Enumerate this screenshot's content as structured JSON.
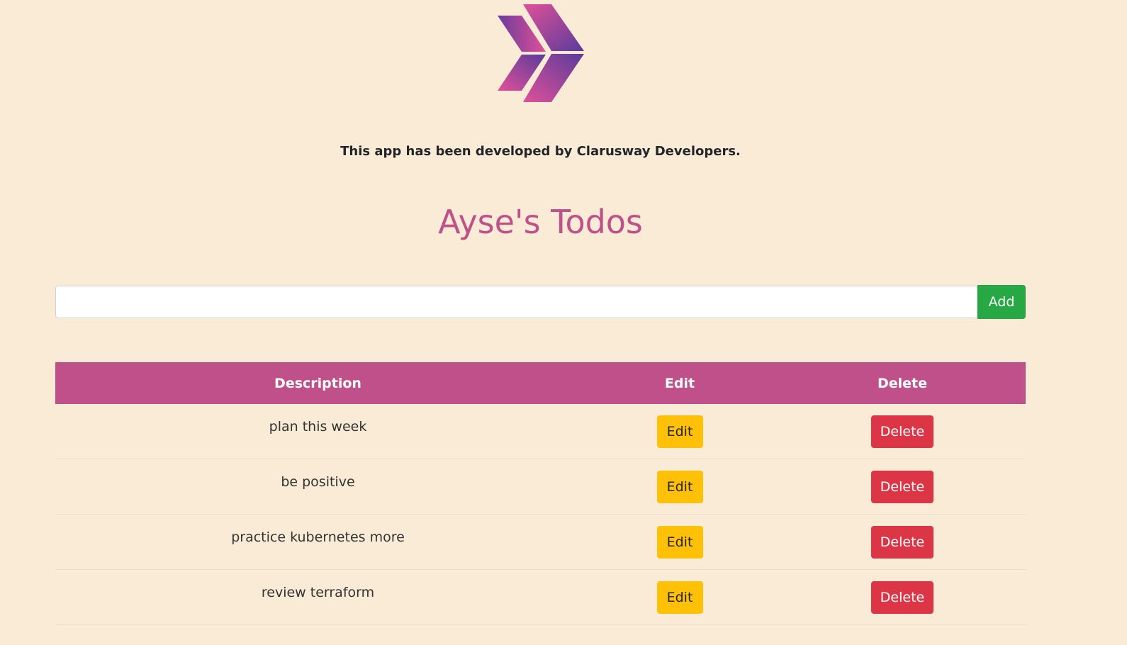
{
  "logo": {
    "icon": "chevron-double-right-icon"
  },
  "credit": "This app has been developed by Clarusway Developers.",
  "title": "Ayse's Todos",
  "add_form": {
    "input_value": "",
    "button_label": "Add"
  },
  "table": {
    "headers": {
      "description": "Description",
      "edit": "Edit",
      "delete": "Delete"
    },
    "rows": [
      {
        "description": "plan this week",
        "edit_label": "Edit",
        "delete_label": "Delete"
      },
      {
        "description": "be positive",
        "edit_label": "Edit",
        "delete_label": "Delete"
      },
      {
        "description": "practice kubernetes more",
        "edit_label": "Edit",
        "delete_label": "Delete"
      },
      {
        "description": "review terraform",
        "edit_label": "Edit",
        "delete_label": "Delete"
      }
    ]
  },
  "colors": {
    "background": "#faebd7",
    "accent": "#c0508a",
    "add_button": "#28a745",
    "edit_button": "#ffc107",
    "delete_button": "#dc3545"
  }
}
